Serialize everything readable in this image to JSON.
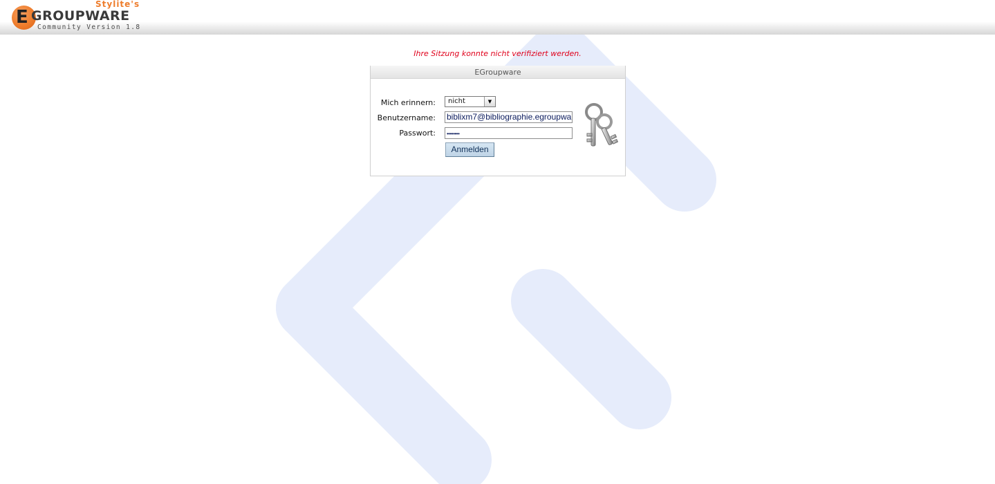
{
  "header": {
    "logo": {
      "brand_prefix": "Stylite's",
      "letter": "E",
      "word": "GROUPWARE",
      "version": "Community Version 1.8"
    }
  },
  "error_message": "Ihre Sitzung konnte nicht verifiziert werden.",
  "login": {
    "title": "EGroupware",
    "remember": {
      "label": "Mich erinnern:",
      "selected": "nicht"
    },
    "username": {
      "label": "Benutzername:",
      "value": "biblixm7@bibliographie.egroupwa"
    },
    "password": {
      "label": "Passwort:",
      "masked_value": "••••••••"
    },
    "submit_label": "Anmelden"
  },
  "icons": {
    "keys": "keys-icon",
    "dropdown": "chevron-down-icon",
    "watermark": "egroupware-watermark"
  },
  "colors": {
    "error": "#e0001b",
    "brand_orange": "#ee7d2c",
    "watermark_blue": "#e6ecfb",
    "button_blue": "#c8dcec"
  }
}
